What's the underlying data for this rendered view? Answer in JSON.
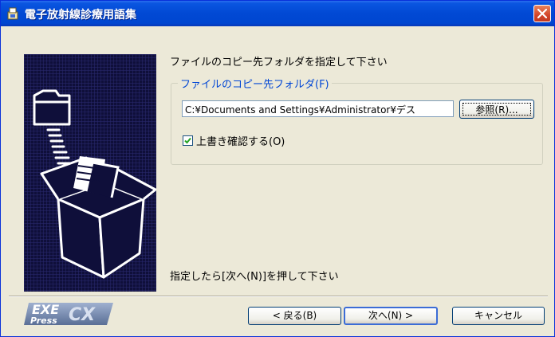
{
  "window": {
    "title": "電子放射線診療用語集",
    "icon": "installer-icon",
    "close_icon": "close-icon"
  },
  "page": {
    "prompt": "ファイルのコピー先フォルダを指定して下さい",
    "group_label": "ファイルのコピー先フォルダ(F)",
    "path_value": "C:¥Documents and Settings¥Administrator¥デス",
    "browse_label": "参照(R)...",
    "overwrite_label": "上書き確認する(O)",
    "overwrite_checked": true,
    "hint": "指定したら[次へ(N)]を押して下さい"
  },
  "footer": {
    "logo_text_top": "EXE",
    "logo_text_bottom": "Press",
    "logo_text_side": "CX",
    "back_label": "< 戻る(B)",
    "next_label": "次へ(N) >",
    "cancel_label": "キャンセル"
  },
  "colors": {
    "title_bar": "#0149d4",
    "close_button": "#d2452a",
    "group_label": "#0046d5",
    "picture_bg": "#0f0f3a"
  }
}
